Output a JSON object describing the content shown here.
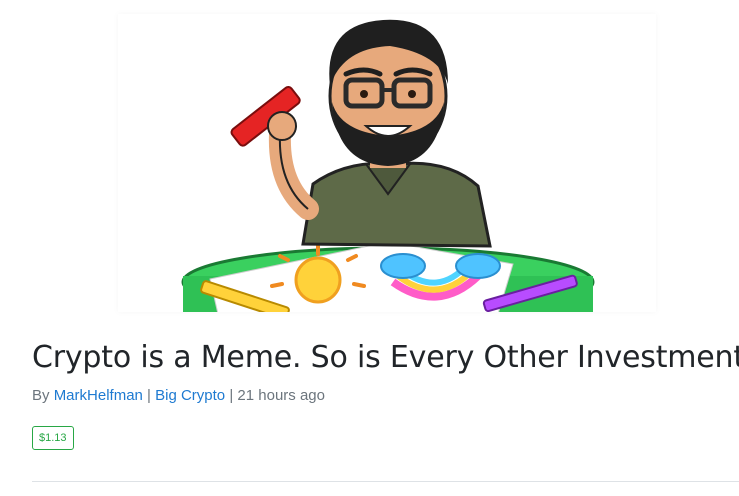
{
  "post": {
    "title": "Crypto is a Meme. So is Every Other Investment",
    "byline_prefix": "By",
    "author": "MarkHelfman",
    "separator": "|",
    "community": "Big Crypto",
    "time": "21 hours ago",
    "payout": "$1.13"
  },
  "hero_image": {
    "subject": "cartoon-avatar-drawing-at-table"
  },
  "colors": {
    "title": "#212529",
    "meta_text": "#6c757d",
    "link": "#1e7ad1",
    "payout": "#28a745",
    "divider": "#dee2e6"
  }
}
